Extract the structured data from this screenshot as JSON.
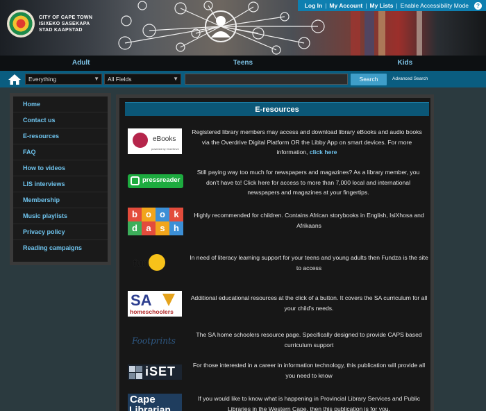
{
  "header": {
    "logo_line1": "CITY OF CAPE TOWN",
    "logo_line2": "ISIXEKO SASEKAPA",
    "logo_line3": "STAD KAAPSTAD",
    "top_links": [
      "Log In",
      "My Account",
      "My Lists",
      "Enable Accessibility Mode"
    ],
    "help_icon": "question-icon"
  },
  "audience_nav": [
    "Adult",
    "Teens",
    "Kids"
  ],
  "search": {
    "scope_selected": "Everything",
    "field_selected": "All Fields",
    "query_value": "",
    "button_label": "Search",
    "advanced_label": "Advanced Search"
  },
  "sidebar": {
    "items": [
      "Home",
      "Contact us",
      "E-resources",
      "FAQ",
      "How to videos",
      "LIS interviews",
      "Membership",
      "Music playlists",
      "Privacy policy",
      "Reading campaigns"
    ]
  },
  "main": {
    "title": "E-resources",
    "resources": [
      {
        "logo_text": "eBooks",
        "logo_sub": "powered by OverDrive",
        "text": "Registered library members may access and download library eBooks and audio books via the Overdrive Digital Platform OR the Libby App on smart devices. For more information,",
        "link": "click here"
      },
      {
        "logo_text": "pressreader",
        "text": "Still paying way too much for newspapers and magazines? As a library member, you don't have to! Click here for access to more than 7,000 local and international newspapers and magazines at your fingertips."
      },
      {
        "logo_text": "book dash",
        "text": "Highly recommended for children. Contains African storybooks in English, IsiXhosa and Afrikaans"
      },
      {
        "logo_text": "funDza",
        "text": "In need of literacy learning support for your teens and young adults then Fundza is the site to access"
      },
      {
        "logo_text": "SA",
        "logo_sub": "homeschoolers",
        "text": "Additional educational resources at the click of a button. It covers the SA curriculum for all your child's needs."
      },
      {
        "logo_text": "Footprints",
        "text": "The SA home schoolers resource page. Specifically designed to provide CAPS based curriculum support"
      },
      {
        "logo_text": "iSET",
        "text": "For those interested in a career in information technology, this publication will provide all you need to know"
      },
      {
        "logo_text": "Cape",
        "logo_sub": "Librarian",
        "text": "If you would like to know what is happening in Provincial Library Services and Public Libraries in the Western Cape, then this publication is for you."
      }
    ]
  },
  "colors": {
    "link_blue": "#6fc4ee",
    "header_blue": "#0e7fb0",
    "search_bar": "#0a5d80",
    "panel_title_bg": "#0b5777",
    "search_button": "#3f9ec9"
  }
}
